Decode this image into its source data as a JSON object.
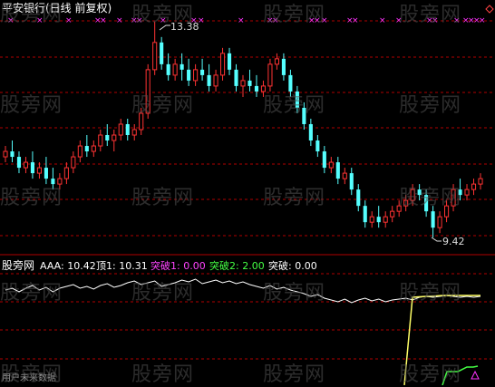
{
  "header": {
    "stock_name": "平安银行(日线 前复权)",
    "high_label": "13.38",
    "low_label": "9.42"
  },
  "indicator": {
    "title": "股旁网",
    "items": [
      {
        "name": "AAA:",
        "value": "10.42",
        "color": "#ffffff"
      },
      {
        "name": "顶1:",
        "value": "10.31",
        "color": "#ffffff"
      },
      {
        "name": "突破1:",
        "value": "0.00",
        "color": "#ff44ff"
      },
      {
        "name": "突破2:",
        "value": "2.00",
        "color": "#44ff44"
      },
      {
        "name": "突破:",
        "value": "0.00",
        "color": "#ffffff"
      }
    ],
    "footer_text": "用户未来数据"
  },
  "watermark": "股旁网",
  "colors": {
    "up": "#ff3333",
    "down": "#55ffff",
    "grid": "#b00000",
    "signal": "#ff33ff",
    "yellow": "#ffff66",
    "green": "#44ff44"
  },
  "chart_data": {
    "type": "candlestick",
    "price_high": 13.38,
    "price_low": 9.42,
    "candles": [
      [
        10.9,
        11.1,
        11.0,
        10.8
      ],
      [
        11.0,
        11.2,
        10.9,
        10.8
      ],
      [
        10.9,
        11.0,
        10.7,
        10.6
      ],
      [
        10.7,
        10.9,
        10.8,
        10.6
      ],
      [
        10.8,
        11.0,
        10.6,
        10.5
      ],
      [
        10.6,
        10.8,
        10.7,
        10.5
      ],
      [
        10.7,
        10.9,
        10.5,
        10.4
      ],
      [
        10.5,
        10.7,
        10.4,
        10.3
      ],
      [
        10.4,
        10.6,
        10.5,
        10.3
      ],
      [
        10.5,
        10.8,
        10.7,
        10.4
      ],
      [
        10.7,
        11.0,
        10.9,
        10.6
      ],
      [
        10.9,
        11.2,
        11.1,
        10.8
      ],
      [
        11.1,
        11.3,
        11.0,
        10.9
      ],
      [
        11.0,
        11.2,
        11.1,
        10.9
      ],
      [
        11.1,
        11.4,
        11.3,
        11.0
      ],
      [
        11.3,
        11.5,
        11.2,
        11.1
      ],
      [
        11.2,
        11.4,
        11.3,
        11.0
      ],
      [
        11.3,
        11.6,
        11.5,
        11.2
      ],
      [
        11.5,
        11.6,
        11.3,
        11.2
      ],
      [
        11.3,
        11.5,
        11.4,
        11.2
      ],
      [
        11.4,
        11.8,
        11.7,
        11.3
      ],
      [
        11.7,
        12.6,
        12.5,
        11.6
      ],
      [
        12.5,
        13.38,
        13.0,
        12.4
      ],
      [
        13.0,
        13.1,
        12.6,
        12.5
      ],
      [
        12.6,
        12.8,
        12.4,
        12.3
      ],
      [
        12.4,
        12.7,
        12.6,
        12.3
      ],
      [
        12.6,
        12.8,
        12.5,
        12.3
      ],
      [
        12.5,
        12.7,
        12.3,
        12.2
      ],
      [
        12.3,
        12.6,
        12.5,
        12.2
      ],
      [
        12.5,
        12.7,
        12.4,
        12.3
      ],
      [
        12.4,
        12.6,
        12.2,
        12.1
      ],
      [
        12.2,
        12.5,
        12.4,
        12.1
      ],
      [
        12.4,
        12.9,
        12.8,
        12.3
      ],
      [
        12.8,
        12.9,
        12.5,
        12.4
      ],
      [
        12.5,
        12.6,
        12.2,
        12.1
      ],
      [
        12.2,
        12.4,
        12.3,
        12.0
      ],
      [
        12.3,
        12.5,
        12.2,
        12.1
      ],
      [
        12.2,
        12.4,
        12.1,
        12.0
      ],
      [
        12.1,
        12.3,
        12.2,
        12.0
      ],
      [
        12.2,
        12.7,
        12.6,
        12.1
      ],
      [
        12.6,
        12.8,
        12.7,
        12.5
      ],
      [
        12.7,
        12.8,
        12.4,
        12.3
      ],
      [
        12.4,
        12.5,
        12.1,
        12.0
      ],
      [
        12.1,
        12.2,
        11.8,
        11.7
      ],
      [
        11.8,
        11.9,
        11.5,
        11.4
      ],
      [
        11.5,
        11.6,
        11.2,
        11.1
      ],
      [
        11.2,
        11.3,
        11.0,
        10.9
      ],
      [
        11.0,
        11.1,
        10.7,
        10.6
      ],
      [
        10.7,
        10.9,
        10.8,
        10.6
      ],
      [
        10.8,
        10.9,
        10.5,
        10.4
      ],
      [
        10.5,
        10.7,
        10.6,
        10.4
      ],
      [
        10.6,
        10.7,
        10.3,
        10.2
      ],
      [
        10.3,
        10.4,
        10.0,
        9.9
      ],
      [
        10.0,
        10.1,
        9.7,
        9.6
      ],
      [
        9.7,
        9.9,
        9.8,
        9.6
      ],
      [
        9.8,
        10.0,
        9.7,
        9.6
      ],
      [
        9.7,
        9.9,
        9.8,
        9.6
      ],
      [
        9.8,
        10.0,
        9.9,
        9.7
      ],
      [
        9.9,
        10.1,
        10.0,
        9.8
      ],
      [
        10.0,
        10.2,
        10.1,
        9.9
      ],
      [
        10.1,
        10.4,
        10.3,
        10.0
      ],
      [
        10.3,
        10.4,
        10.2,
        10.1
      ],
      [
        10.2,
        10.3,
        9.9,
        9.8
      ],
      [
        9.9,
        10.0,
        9.6,
        9.42
      ],
      [
        9.6,
        9.9,
        9.8,
        9.5
      ],
      [
        9.8,
        10.1,
        10.0,
        9.7
      ],
      [
        10.0,
        10.4,
        10.3,
        9.9
      ],
      [
        10.3,
        10.5,
        10.2,
        10.1
      ],
      [
        10.2,
        10.4,
        10.3,
        10.1
      ],
      [
        10.3,
        10.5,
        10.4,
        10.2
      ],
      [
        10.4,
        10.6,
        10.5,
        10.3
      ]
    ]
  }
}
